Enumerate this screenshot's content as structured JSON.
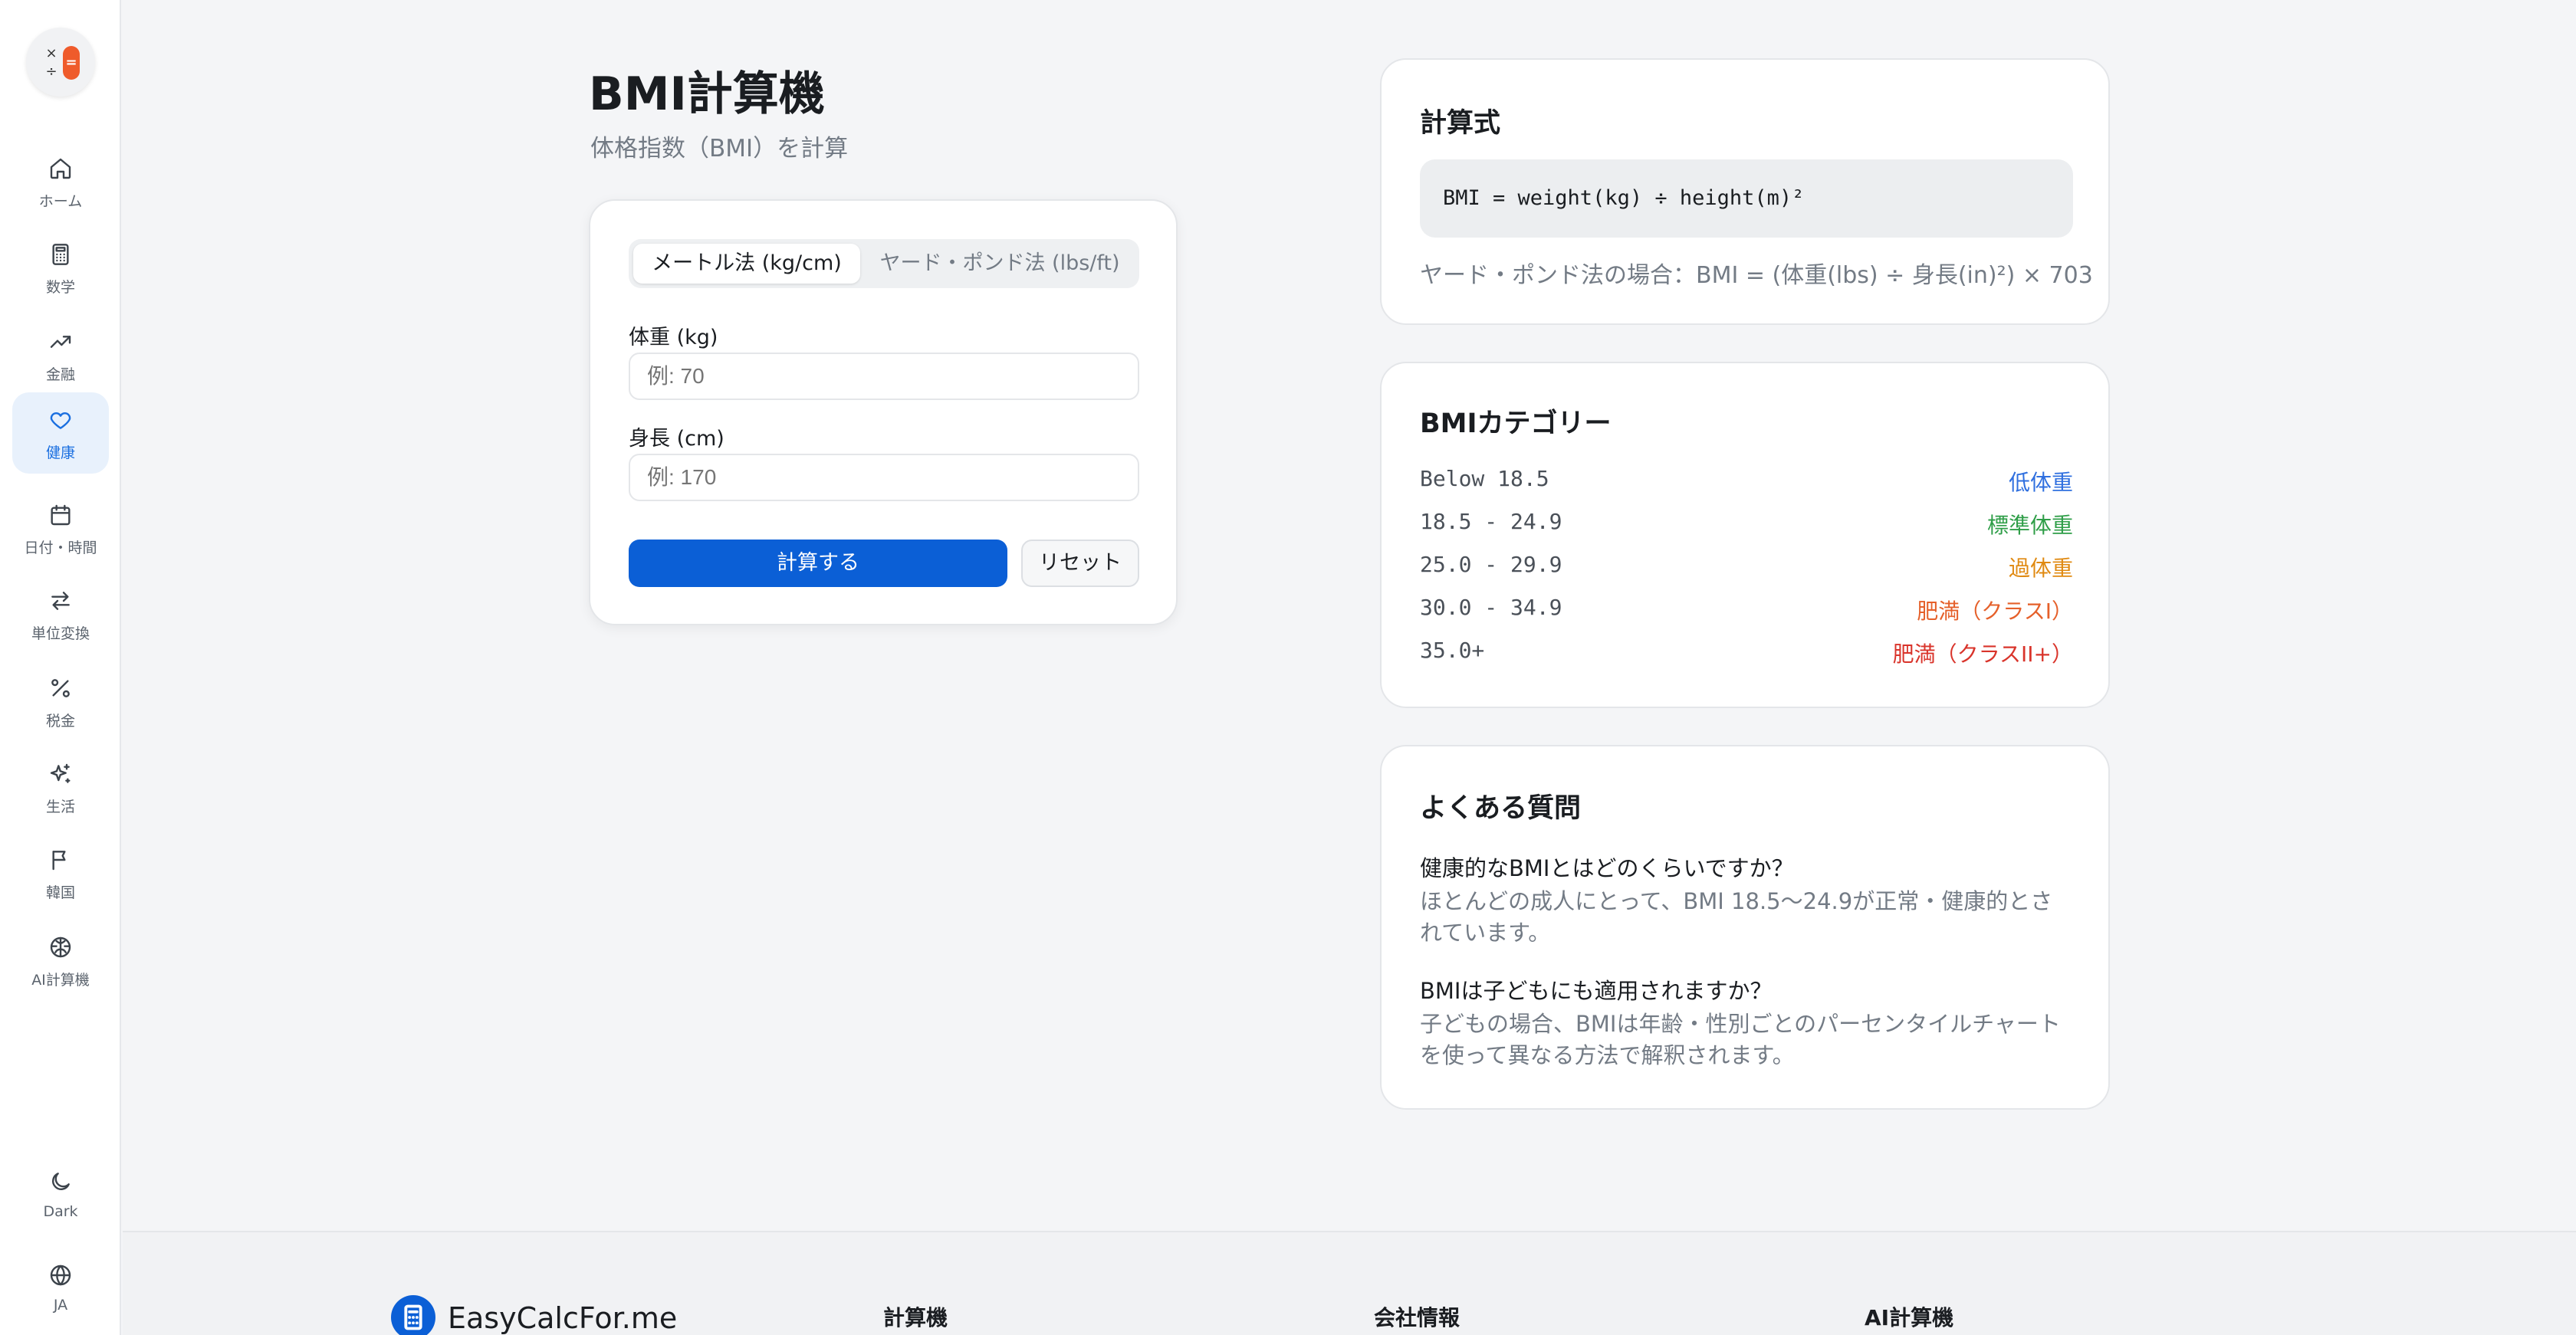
{
  "sidebar": {
    "items": [
      {
        "label": "ホーム",
        "icon": "home-icon"
      },
      {
        "label": "数学",
        "icon": "calculator-icon"
      },
      {
        "label": "金融",
        "icon": "trending-up-icon"
      },
      {
        "label": "健康",
        "icon": "heart-icon",
        "active": true
      },
      {
        "label": "日付・時間",
        "icon": "calendar-icon"
      },
      {
        "label": "単位変換",
        "icon": "swap-icon"
      },
      {
        "label": "税金",
        "icon": "percent-icon"
      },
      {
        "label": "生活",
        "icon": "sparkles-icon"
      },
      {
        "label": "韓国",
        "icon": "flag-icon"
      },
      {
        "label": "AI計算機",
        "icon": "brain-icon"
      }
    ],
    "theme_label": "Dark",
    "lang_label": "JA"
  },
  "page": {
    "title": "BMI計算機",
    "subtitle": "体格指数（BMI）を計算"
  },
  "calculator": {
    "unit_metric": "メートル法 (kg/cm)",
    "unit_imperial": "ヤード・ポンド法 (lbs/ft)",
    "weight_label": "体重 (kg)",
    "weight_placeholder": "例: 70",
    "height_label": "身長 (cm)",
    "height_placeholder": "例: 170",
    "calculate_label": "計算する",
    "reset_label": "リセット"
  },
  "formula": {
    "title": "計算式",
    "code": "BMI = weight(kg) ÷ height(m)²",
    "note": "ヤード・ポンド法の場合：BMI = (体重(lbs) ÷ 身長(in)²) × 703"
  },
  "categories": {
    "title": "BMIカテゴリー",
    "rows": [
      {
        "range": "Below 18.5",
        "name": "低体重",
        "color": "#2f6fdf"
      },
      {
        "range": "18.5 - 24.9",
        "name": "標準体重",
        "color": "#2f9e48"
      },
      {
        "range": "25.0 - 29.9",
        "name": "過体重",
        "color": "#e08a12"
      },
      {
        "range": "30.0 - 34.9",
        "name": "肥満（クラスI）",
        "color": "#e5602a"
      },
      {
        "range": "35.0+",
        "name": "肥満（クラスII+）",
        "color": "#d9342b"
      }
    ]
  },
  "faq": {
    "title": "よくある質問",
    "items": [
      {
        "q": "健康的なBMIとはどのくらいですか？",
        "a": "ほとんどの成人にとって、BMI 18.5〜24.9が正常・健康的とされています。"
      },
      {
        "q": "BMIは子どもにも適用されますか？",
        "a": "子どもの場合、BMIは年齢・性別ごとのパーセンタイルチャートを使って異なる方法で解釈されます。"
      }
    ]
  },
  "footer": {
    "brand": "EasyCalcFor.me",
    "col1": "計算機",
    "col2": "会社情報",
    "col3": "AI計算機"
  }
}
